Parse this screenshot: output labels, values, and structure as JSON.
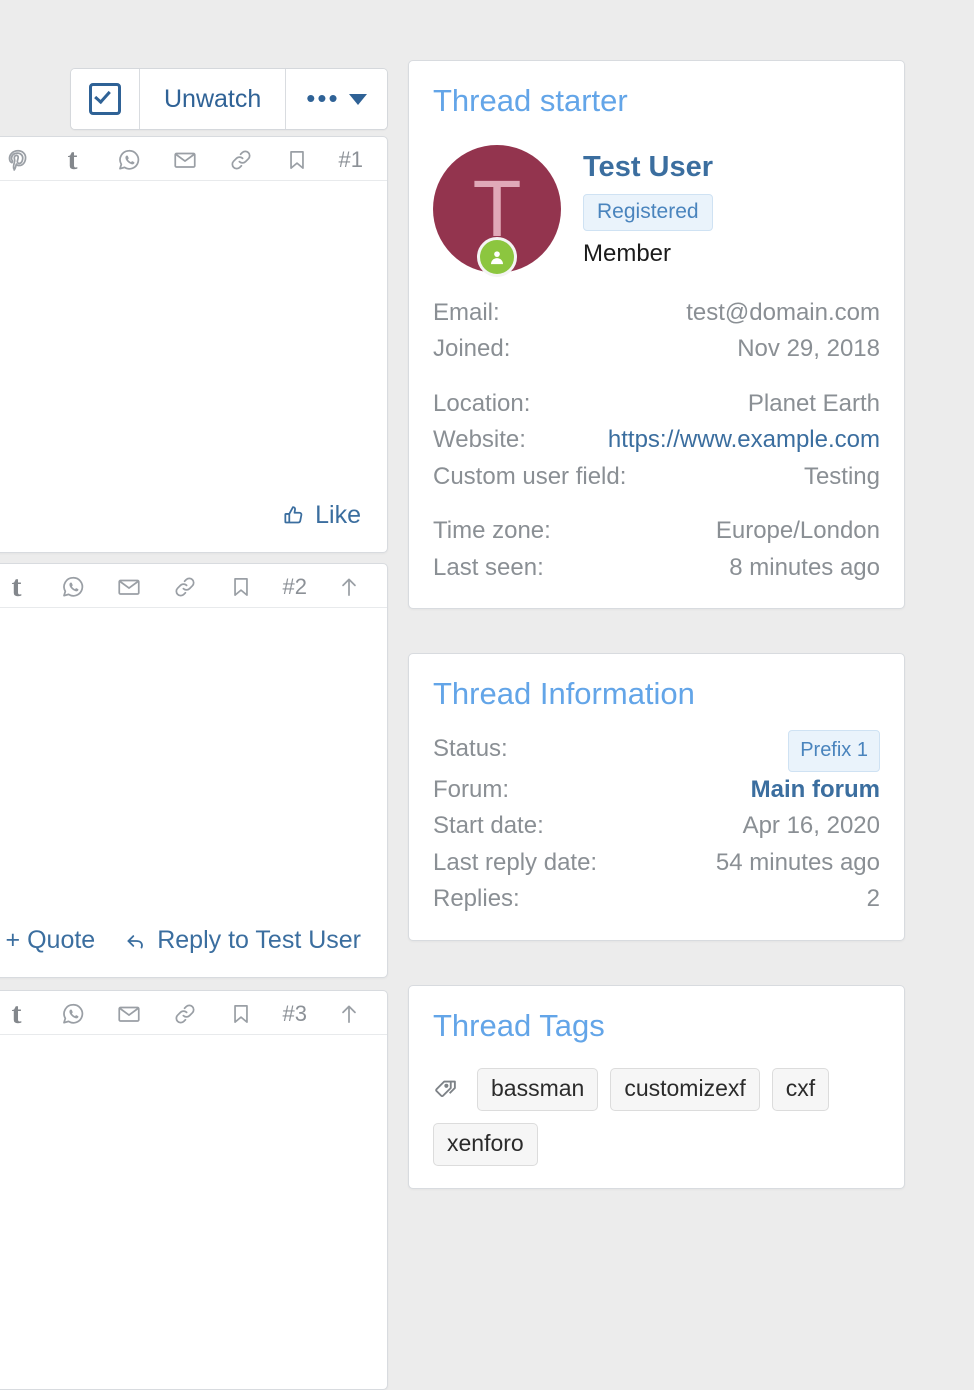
{
  "theme": {
    "page_background": "#ececec",
    "card_background": "#ffffff",
    "card_border": "#d8dbdf",
    "heading_blue": "#63a5e8",
    "link_blue": "#3b6e9f",
    "muted_text": "#8a8f94",
    "avatar_background": "#93344e",
    "online_green": "#8cc63f"
  },
  "thread_toolbar": {
    "watch_checkbox_icon": "checkbox-checked-icon",
    "watch_label": "Unwatch",
    "more_icon": "ellipsis-icon",
    "more_caret_icon": "caret-down-icon"
  },
  "posts": [
    {
      "id": "post-1",
      "share_icons": [
        "pinterest-icon",
        "tumblr-icon",
        "whatsapp-icon",
        "email-icon",
        "link-icon",
        "bookmark-icon"
      ],
      "post_number": "#1",
      "jump_icon": null,
      "footer_actions": [
        {
          "label": "Like",
          "icon": "thumbs-up-icon"
        }
      ]
    },
    {
      "id": "post-2",
      "share_icons": [
        "tumblr-icon",
        "whatsapp-icon",
        "email-icon",
        "link-icon",
        "bookmark-icon"
      ],
      "post_number": "#2",
      "jump_icon": "arrow-up-icon",
      "footer_actions": [
        {
          "label": "+ Quote",
          "icon": null
        },
        {
          "label": "Reply to Test User",
          "icon": "reply-icon"
        }
      ]
    },
    {
      "id": "post-3",
      "share_icons": [
        "tumblr-icon",
        "whatsapp-icon",
        "email-icon",
        "link-icon",
        "bookmark-icon"
      ],
      "post_number": "#3",
      "jump_icon": "arrow-up-icon",
      "footer_actions": []
    }
  ],
  "sidebar": {
    "thread_starter": {
      "title": "Thread starter",
      "avatar_letter": "T",
      "online_icon": "user-online-icon",
      "username": "Test User",
      "user_banner": "Registered",
      "user_title": "Member",
      "details": [
        {
          "key": "Email:",
          "value": "test@domain.com",
          "style": "plain"
        },
        {
          "key": "Joined:",
          "value": "Nov 29, 2018",
          "style": "plain"
        },
        {
          "key": "Location:",
          "value": "Planet Earth",
          "style": "plain",
          "group_start": true
        },
        {
          "key": "Website:",
          "value": "https://www.example.com",
          "style": "link"
        },
        {
          "key": "Custom user field:",
          "value": "Testing",
          "style": "plain"
        },
        {
          "key": "Time zone:",
          "value": "Europe/London",
          "style": "plain",
          "group_start": true
        },
        {
          "key": "Last seen:",
          "value": "8 minutes ago",
          "style": "plain"
        }
      ]
    },
    "thread_information": {
      "title": "Thread Information",
      "details": [
        {
          "key": "Status:",
          "value": "Prefix 1",
          "style": "pill"
        },
        {
          "key": "Forum:",
          "value": "Main forum",
          "style": "strong-link"
        },
        {
          "key": "Start date:",
          "value": "Apr 16, 2020",
          "style": "plain"
        },
        {
          "key": "Last reply date:",
          "value": "54 minutes ago",
          "style": "plain"
        },
        {
          "key": "Replies:",
          "value": "2",
          "style": "plain"
        }
      ]
    },
    "thread_tags": {
      "title": "Thread Tags",
      "tag_icon": "tags-icon",
      "tags": [
        "bassman",
        "customizexf",
        "cxf",
        "xenforo"
      ]
    }
  }
}
